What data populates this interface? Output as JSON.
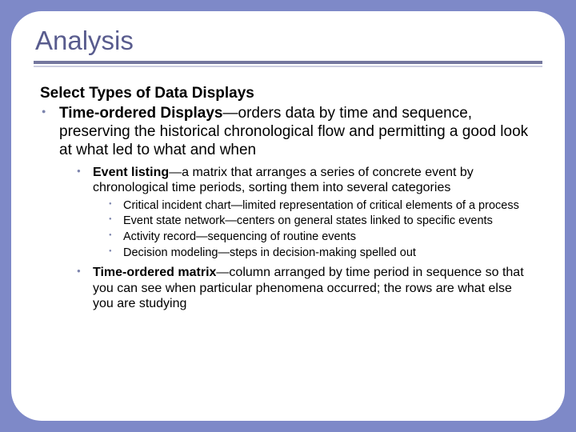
{
  "title": "Analysis",
  "heading": "Select Types of Data Displays",
  "l1": {
    "lead": "Time-ordered Displays",
    "text": "—orders data by time and sequence, preserving the historical chronological flow and permitting a good look at what led to what and when"
  },
  "l2a": {
    "lead": "Event listing",
    "text": "—a matrix that arranges a series of concrete event by chronological time periods, sorting them into several categories"
  },
  "l3": {
    "i0": "Critical incident chart—limited representation of critical elements of a process",
    "i1": "Event state network—centers on general states linked to specific events",
    "i2": "Activity record—sequencing of routine events",
    "i3": "Decision modeling—steps in decision-making spelled out"
  },
  "l2b": {
    "lead": "Time-ordered matrix",
    "text": "—column arranged by time period in sequence so that you can see when particular phenomena occurred; the rows are what else you are studying"
  }
}
